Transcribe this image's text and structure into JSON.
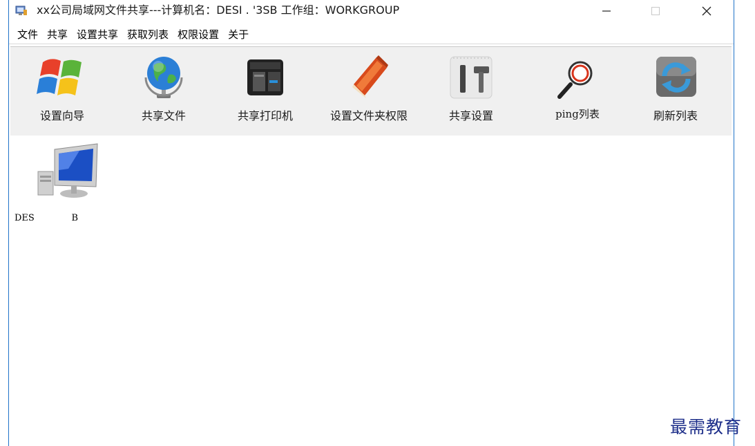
{
  "window": {
    "title": "xx公司局域网文件共享---计算机名：DESI        .          '3SB  工作组：WORKGROUP",
    "controls": {
      "minimize": "—",
      "maximize": "☐",
      "close": "✕"
    }
  },
  "menubar": {
    "items": [
      {
        "label": "文件"
      },
      {
        "label": "共享"
      },
      {
        "label": "设置共享"
      },
      {
        "label": "获取列表"
      },
      {
        "label": "权限设置"
      },
      {
        "label": "关于"
      }
    ]
  },
  "toolbar": {
    "items": [
      {
        "label": "设置向导",
        "icon": "windows-logo-icon"
      },
      {
        "label": "共享文件",
        "icon": "globe-icon"
      },
      {
        "label": "共享打印机",
        "icon": "printer-icon"
      },
      {
        "label": "设置文件夹权限",
        "icon": "notebook-icon"
      },
      {
        "label": "共享设置",
        "icon": "tools-icon"
      },
      {
        "label": "ping列表",
        "icon": "magnifier-icon"
      },
      {
        "label": "刷新列表",
        "icon": "refresh-icon"
      }
    ]
  },
  "computers": [
    {
      "name": "DES             B",
      "icon": "computer-icon"
    }
  ],
  "watermark": "最需教育",
  "colors": {
    "window_border": "#1f72c8",
    "toolbar_bg": "#f0f0f0",
    "watermark": "#1e2f8a"
  }
}
